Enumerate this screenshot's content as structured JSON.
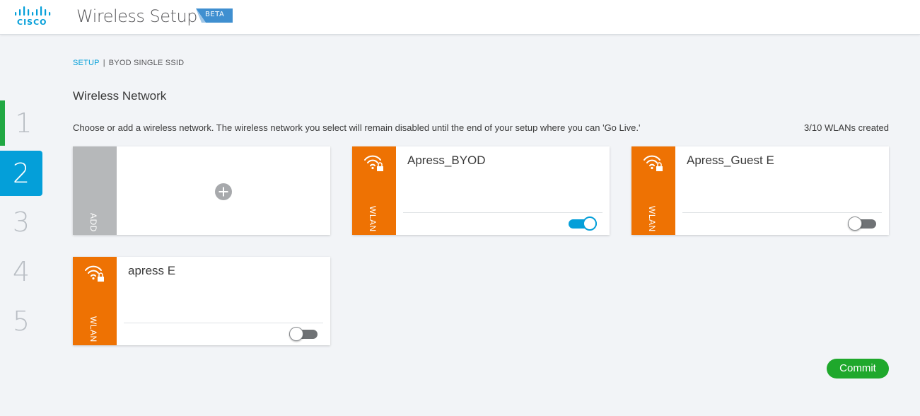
{
  "header": {
    "logo_text": "CISCO",
    "title": "Wireless Setup",
    "badge": "BETA"
  },
  "steps": [
    {
      "label": "1",
      "state": "done"
    },
    {
      "label": "2",
      "state": "active"
    },
    {
      "label": "3",
      "state": "pending"
    },
    {
      "label": "4",
      "state": "pending"
    },
    {
      "label": "5",
      "state": "pending"
    }
  ],
  "breadcrumb": {
    "link": "SETUP",
    "separator": "|",
    "current": "BYOD SINGLE SSID"
  },
  "section": {
    "title": "Wireless Network",
    "instructions": "Choose or add a wireless network. The wireless network you select will remain disabled until the end of your setup where you can 'Go Live.'",
    "count": "3/10 WLANs created"
  },
  "add_card": {
    "side_label": "ADD",
    "icon": "plus-circle-icon"
  },
  "wlans": [
    {
      "name": "Apress_BYOD",
      "side_label": "WLAN",
      "icon": "wifi-lock-icon",
      "enabled": true
    },
    {
      "name": "Apress_Guest E",
      "side_label": "WLAN",
      "icon": "wifi-lock-icon",
      "enabled": false
    },
    {
      "name": "apress E",
      "side_label": "WLAN",
      "icon": "wifi-lock-icon",
      "enabled": false
    }
  ],
  "commit_label": "Commit",
  "colors": {
    "accent": "#049fd9",
    "wlan": "#ee7203",
    "add": "#b6b8ba",
    "success": "#1fa82c",
    "step_done": "#21a843"
  }
}
